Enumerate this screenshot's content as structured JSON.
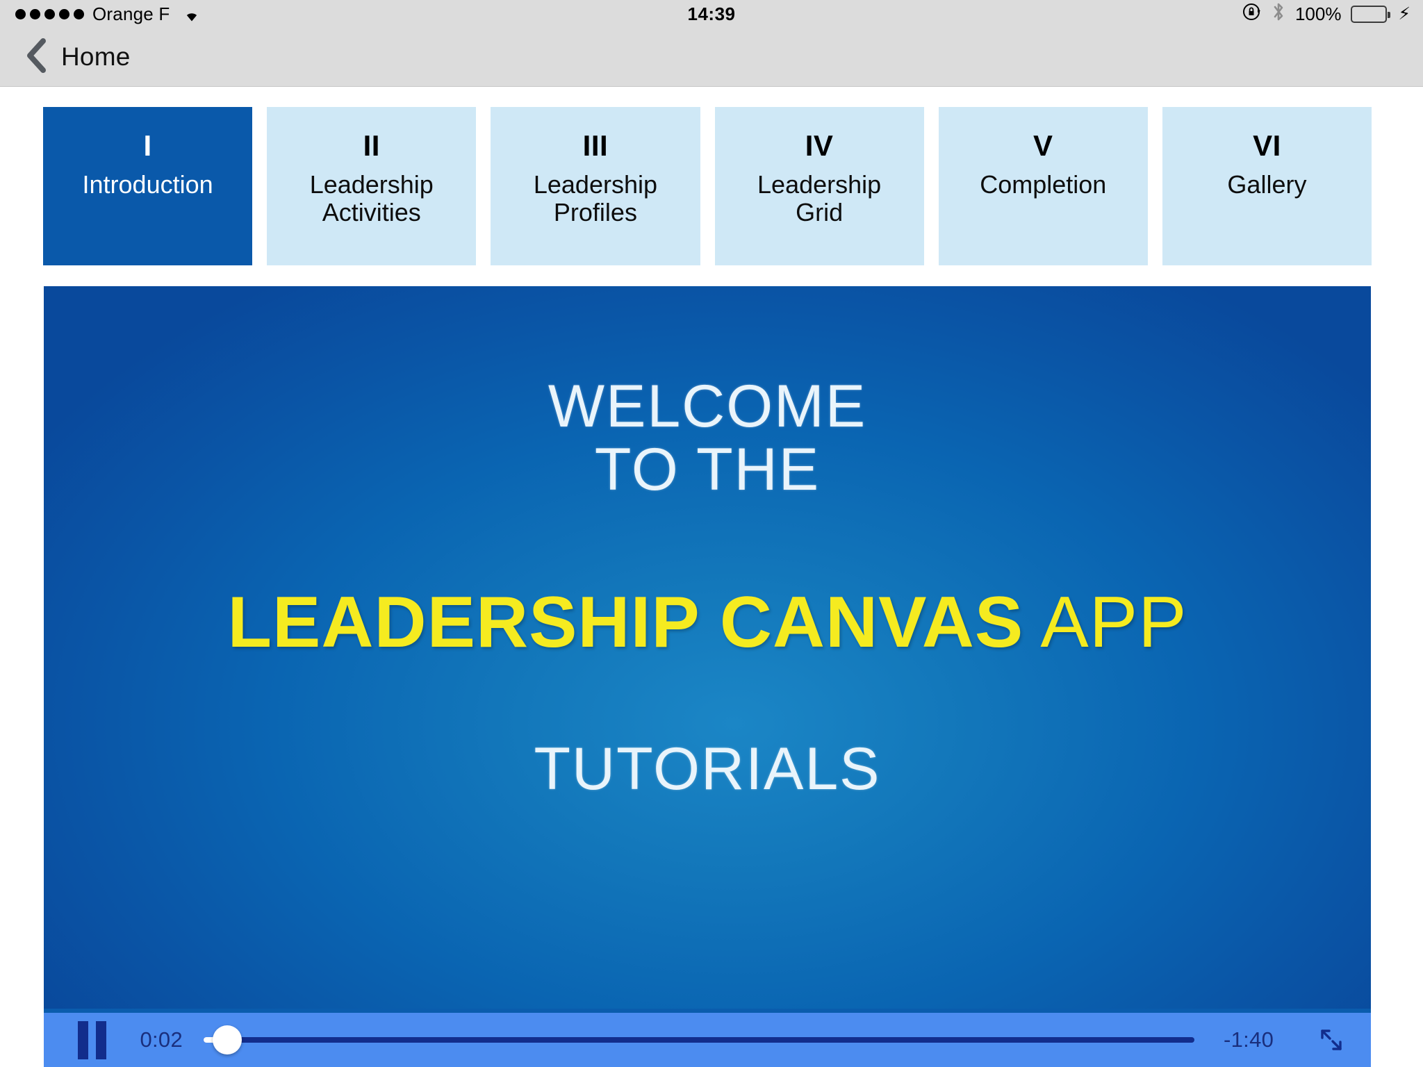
{
  "status_bar": {
    "signal_dots": 5,
    "carrier": "Orange F",
    "wifi_icon": "wifi-icon",
    "time": "14:39",
    "rotation_lock_icon": "rotation-lock-icon",
    "bluetooth_icon": "bluetooth-icon",
    "battery_percent": "100%",
    "battery_level": 100,
    "charging_icon": "lightning-bolt-icon"
  },
  "nav_bar": {
    "back_icon": "chevron-left-icon",
    "back_label": "Home"
  },
  "tabs": [
    {
      "numeral": "I",
      "label": "Introduction",
      "active": true
    },
    {
      "numeral": "II",
      "label": "Leadership\nActivities",
      "active": false
    },
    {
      "numeral": "III",
      "label": "Leadership\nProfiles",
      "active": false
    },
    {
      "numeral": "IV",
      "label": "Leadership\nGrid",
      "active": false
    },
    {
      "numeral": "V",
      "label": "Completion",
      "active": false
    },
    {
      "numeral": "VI",
      "label": "Gallery",
      "active": false
    }
  ],
  "video": {
    "slide_top": "WELCOME\nTO THE",
    "brand_strong": "LEADERSHIP CANVAS",
    "brand_light": " APP",
    "slide_bottom": "TUTORIALS",
    "background_color": "#0a5cad",
    "brand_color": "#f5eb20",
    "slide_text_color": "#e9f4fb"
  },
  "player_controls": {
    "state": "playing",
    "pause_icon": "pause-icon",
    "elapsed": "0:02",
    "remaining": "-1:40",
    "progress_percent": 2.4,
    "fullscreen_icon": "fullscreen-expand-icon",
    "bar_color": "#4c8cf0",
    "accent_color": "#122d8c"
  },
  "theme": {
    "active_tab_color": "#0a59aa",
    "inactive_tab_color": "#cfe8f6",
    "chrome_color": "#dcdcdc"
  }
}
